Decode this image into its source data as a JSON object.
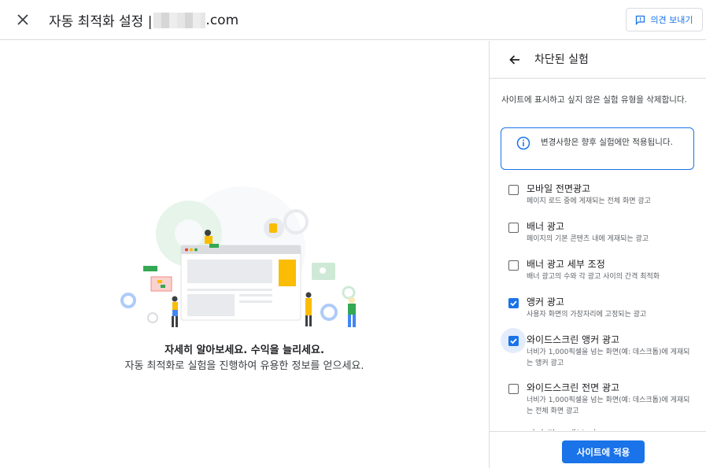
{
  "header": {
    "title_prefix": "자동 최적화 설정 |",
    "title_suffix": ".com",
    "feedback_label": "의견 보내기"
  },
  "main": {
    "headline": "자세히 알아보세요. 수익을 늘리세요.",
    "subtext": "자동 최적화로 실험을 진행하여 유용한 정보를 얻으세요."
  },
  "panel": {
    "title": "차단된 실험",
    "description": "사이트에 표시하고 싶지 않은 실험 유형을 삭제합니다.",
    "info": "변경사항은 향후 실험에만 적용됩니다.",
    "items": [
      {
        "label": "모바일 전면광고",
        "desc": "페이지 로드 중에 게재되는 전체 화면 광고",
        "checked": false
      },
      {
        "label": "배너 광고",
        "desc": "페이지의 기본 콘텐츠 내에 게재되는 광고",
        "checked": false
      },
      {
        "label": "배너 광고 세부 조정",
        "desc": "배너 광고의 수와 각 광고 사이의 간격 최적화",
        "checked": false
      },
      {
        "label": "앵커 광고",
        "desc": "사용자 화면의 가장자리에 고정되는 광고",
        "checked": true
      },
      {
        "label": "와이드스크린 앵커 광고",
        "desc": "너비가 1,000픽셀을 넘는 화면(예: 데스크톱)에 게재되는 앵커 광고",
        "checked": true
      },
      {
        "label": "와이드스크린 전면 광고",
        "desc": "너비가 1,000픽셀을 넘는 화면(예: 데스크톱)에 게재되는 전체 화면 광고",
        "checked": false
      },
      {
        "label": "전면 광고 세부 시도",
        "desc": "",
        "checked": false
      }
    ],
    "apply_label": "사이트에 적용"
  },
  "colors": {
    "accent": "#1a73e8",
    "divider": "#dadce0",
    "text": "#202124",
    "muted": "#5f6368"
  },
  "icons": {
    "close": "close-icon",
    "feedback": "feedback-icon",
    "back": "arrow-back-icon",
    "info": "info-icon",
    "check": "check-icon"
  }
}
